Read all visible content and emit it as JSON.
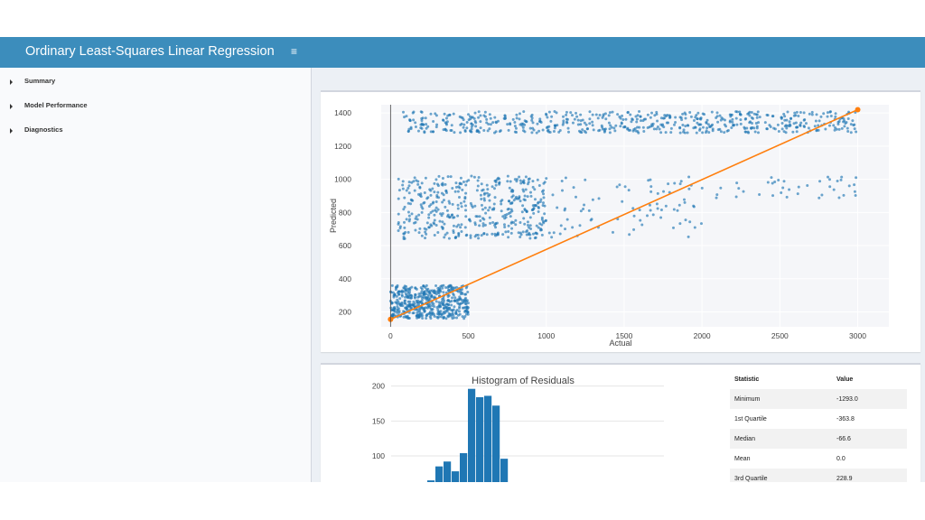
{
  "header": {
    "title": "Ordinary Least-Squares Linear Regression",
    "menu_icon": "hamburger-icon"
  },
  "sidebar": {
    "items": [
      {
        "label": "Summary",
        "icon": "caret-right-icon"
      },
      {
        "label": "Model Performance",
        "icon": "caret-right-icon"
      },
      {
        "label": "Diagnostics",
        "icon": "caret-right-icon"
      }
    ]
  },
  "colors": {
    "header": "#3c8dbc",
    "points": "#1f77b4",
    "fit_line": "#ff7f0e",
    "bars": "#1f77b4"
  },
  "chart_data": [
    {
      "type": "scatter",
      "title": "",
      "xlabel": "Actual",
      "ylabel": "Predicted",
      "x_ticks": [
        0,
        500,
        1000,
        1500,
        2000,
        2500,
        3000
      ],
      "y_ticks": [
        200,
        400,
        600,
        800,
        1000,
        1200,
        1400
      ],
      "xlim": [
        -60,
        3200
      ],
      "ylim": [
        110,
        1450
      ],
      "clusters": [
        {
          "x_range": [
            0,
            500
          ],
          "y_range": [
            160,
            360
          ],
          "count": 500
        },
        {
          "x_range": [
            50,
            1000
          ],
          "y_range": [
            640,
            1020
          ],
          "count": 450
        },
        {
          "x_range": [
            1000,
            2000
          ],
          "y_range": [
            640,
            1020
          ],
          "count": 80
        },
        {
          "x_range": [
            2000,
            3000
          ],
          "y_range": [
            880,
            1020
          ],
          "count": 40
        },
        {
          "x_range": [
            50,
            3000
          ],
          "y_range": [
            1280,
            1410
          ],
          "count": 600
        }
      ],
      "fit_line": {
        "x": [
          0,
          3000
        ],
        "y": [
          155,
          1420
        ]
      },
      "grid": true
    },
    {
      "type": "bar",
      "title": "Histogram of Residuals",
      "y_ticks": [
        100,
        150,
        200
      ],
      "ylim": [
        60,
        215
      ],
      "values": [
        65,
        85,
        92,
        78,
        104,
        196,
        184,
        186,
        172,
        96
      ]
    }
  ],
  "stats_table": {
    "headers": [
      "Statistic",
      "Value"
    ],
    "rows": [
      [
        "Minimum",
        "-1293.0"
      ],
      [
        "1st Quartile",
        "-363.8"
      ],
      [
        "Median",
        "-66.6"
      ],
      [
        "Mean",
        "0.0"
      ],
      [
        "3rd Quartile",
        "228.9"
      ]
    ]
  }
}
